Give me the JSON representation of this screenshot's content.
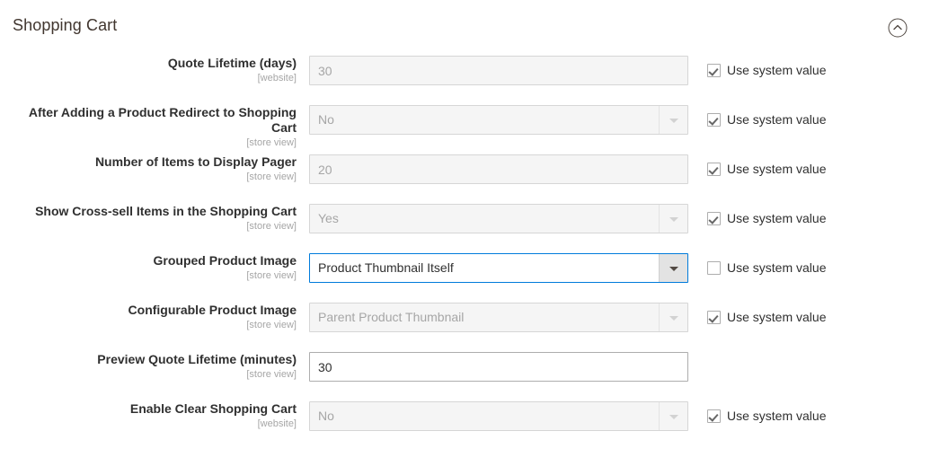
{
  "section": {
    "title": "Shopping Cart",
    "collapse_icon": "chevron-up-circle-icon",
    "expanded": true
  },
  "system_value_label": "Use system value",
  "accent_focus_color": "#007bdb",
  "disabled_field_bg": "#f5f5f5",
  "fields": [
    {
      "label": "Quote Lifetime (days)",
      "scope": "[website]",
      "control": "text",
      "value": "30",
      "disabled": true,
      "has_system_value": true,
      "system_value_checked": true
    },
    {
      "label": "After Adding a Product Redirect to Shopping Cart",
      "scope": "[store view]",
      "control": "select",
      "value": "No",
      "disabled": true,
      "has_system_value": true,
      "system_value_checked": true
    },
    {
      "label": "Number of Items to Display Pager",
      "scope": "[store view]",
      "control": "text",
      "value": "20",
      "disabled": true,
      "has_system_value": true,
      "system_value_checked": true
    },
    {
      "label": "Show Cross-sell Items in the Shopping Cart",
      "scope": "[store view]",
      "control": "select",
      "value": "Yes",
      "disabled": true,
      "has_system_value": true,
      "system_value_checked": true
    },
    {
      "label": "Grouped Product Image",
      "scope": "[store view]",
      "control": "select",
      "value": "Product Thumbnail Itself",
      "disabled": false,
      "active": true,
      "has_system_value": true,
      "system_value_checked": false
    },
    {
      "label": "Configurable Product Image",
      "scope": "[store view]",
      "control": "select",
      "value": "Parent Product Thumbnail",
      "disabled": true,
      "has_system_value": true,
      "system_value_checked": true
    },
    {
      "label": "Preview Quote Lifetime (minutes)",
      "scope": "[store view]",
      "control": "text",
      "value": "30",
      "disabled": false,
      "has_system_value": false,
      "system_value_checked": false
    },
    {
      "label": "Enable Clear Shopping Cart",
      "scope": "[website]",
      "control": "select",
      "value": "No",
      "disabled": true,
      "has_system_value": true,
      "system_value_checked": true
    }
  ]
}
